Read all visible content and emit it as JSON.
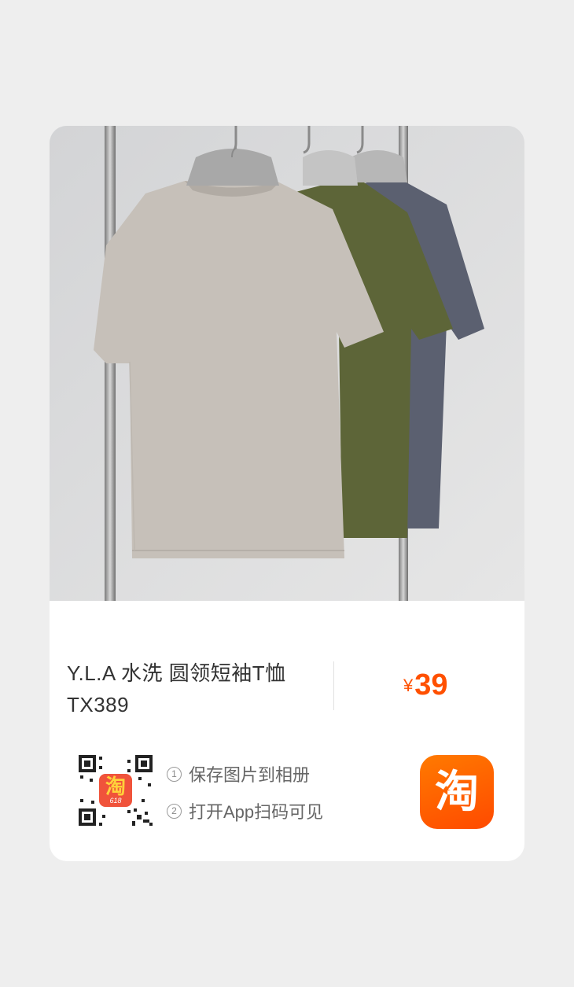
{
  "product": {
    "title": "Y.L.A 水洗 圆领短袖T恤 TX389",
    "price_currency": "¥",
    "price_value": "39"
  },
  "share": {
    "qr_center_logo_text": "淘",
    "qr_center_logo_sub": "618",
    "step1_num": "1",
    "step1_text": "保存图片到相册",
    "step2_num": "2",
    "step2_text": "打开App扫码可见",
    "app_logo_text": "淘"
  },
  "colors": {
    "price": "#ff5000",
    "app_logo": "#ff5a00",
    "shirt_front": "#c6c0b9",
    "shirt_middle": "#5d6538",
    "shirt_back": "#5b6070"
  }
}
